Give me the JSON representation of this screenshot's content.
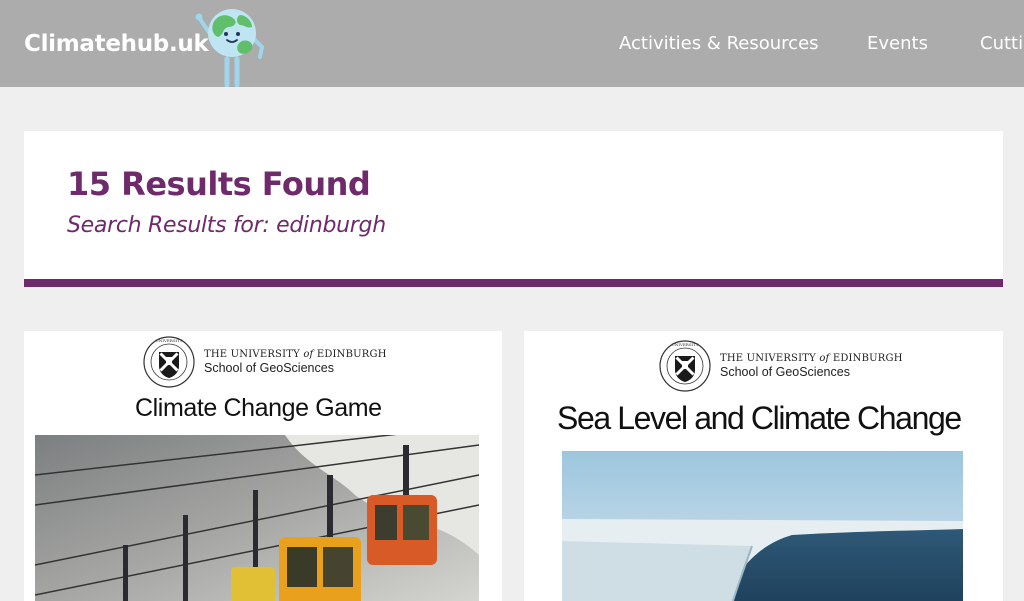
{
  "header": {
    "logo_text": "Climatehub.uk",
    "mascot_icon": "globe-mascot-icon",
    "nav": [
      {
        "label": "Activities & Resources"
      },
      {
        "label": "Events"
      },
      {
        "label": "Cutti"
      }
    ],
    "colors": {
      "header_bg": "#acacac",
      "text": "#ffffff"
    }
  },
  "search": {
    "results_count": "15 Results Found",
    "results_subtitle": "Search Results for: edinburgh",
    "accent_color": "#6f2a6c"
  },
  "results": [
    {
      "org_line1_pre": "THE UNIVERSITY ",
      "org_line1_of": "of",
      "org_line1_post": " EDINBURGH",
      "org_line2": "School of GeoSciences",
      "title": "Climate Change Game",
      "image_icon": "cable-car-photo"
    },
    {
      "org_line1_pre": "THE UNIVERSITY ",
      "org_line1_of": "of",
      "org_line1_post": " EDINBURGH",
      "org_line2": "School of GeoSciences",
      "title": "Sea Level and Climate Change",
      "image_icon": "ice-shelf-photo"
    }
  ]
}
